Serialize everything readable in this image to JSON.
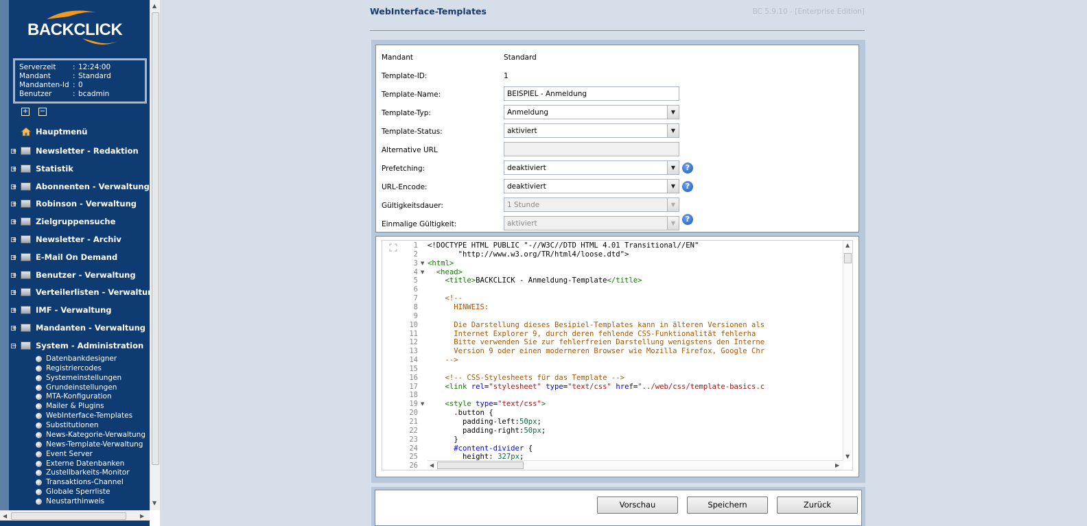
{
  "sidebar": {
    "logo_text": "BACKCLICK",
    "info": [
      {
        "key": "Serverzeit",
        "sep": ":",
        "value": "12:24:00"
      },
      {
        "key": "Mandant",
        "sep": ":",
        "value": "Standard"
      },
      {
        "key": "Mandanten-Id",
        "sep": ":",
        "value": "0"
      },
      {
        "key": "Benutzer",
        "sep": ":",
        "value": "bcadmin"
      }
    ],
    "expand_all": "+",
    "collapse_all": "−",
    "home": "Hauptmenü",
    "items": [
      {
        "label": "Newsletter - Redaktion",
        "exp": "+"
      },
      {
        "label": "Statistik",
        "exp": "+"
      },
      {
        "label": "Abonnenten - Verwaltung",
        "exp": "+"
      },
      {
        "label": "Robinson - Verwaltung",
        "exp": "+"
      },
      {
        "label": "Zielgruppensuche",
        "exp": "+"
      },
      {
        "label": "Newsletter - Archiv",
        "exp": "+"
      },
      {
        "label": "E-Mail On Demand",
        "exp": "+"
      },
      {
        "label": "Benutzer - Verwaltung",
        "exp": "+"
      },
      {
        "label": "Verteilerlisten - Verwaltung",
        "exp": "+"
      },
      {
        "label": "IMF - Verwaltung",
        "exp": "+"
      },
      {
        "label": "Mandanten - Verwaltung",
        "exp": "+"
      },
      {
        "label": "System - Administration",
        "exp": "−"
      }
    ],
    "subitems": [
      "Datenbankdesigner",
      "Registriercodes",
      "Systemeinstellungen",
      "Grundeinstellungen",
      "MTA-Konfiguration",
      "Mailer & Plugins",
      "WebInterface-Templates",
      "Substitutionen",
      "News-Kategorie-Verwaltung",
      "News-Template-Verwaltung",
      "Event Server",
      "Externe Datenbanken",
      "Zustellbarkeits-Monitor",
      "Transaktions-Channel",
      "Globale Sperrliste",
      "Neustarthinweis"
    ]
  },
  "header": {
    "title": "WebInterface-Templates",
    "version": "BC 5.9.10 - [Enterprise Edition]"
  },
  "form": {
    "mandant_label": "Mandant",
    "mandant_value": "Standard",
    "template_id_label": "Template-ID:",
    "template_id_value": "1",
    "template_name_label": "Template-Name:",
    "template_name_value": "BEISPIEL - Anmeldung",
    "template_typ_label": "Template-Typ:",
    "template_typ_value": "Anmeldung",
    "template_status_label": "Template-Status:",
    "template_status_value": "aktiviert",
    "alt_url_label": "Alternative URL",
    "alt_url_value": "",
    "prefetching_label": "Prefetching:",
    "prefetching_value": "deaktiviert",
    "url_encode_label": "URL-Encode:",
    "url_encode_value": "deaktiviert",
    "gueltigkeit_label": "Gültigkeitsdauer:",
    "gueltigkeit_value": "1 Stunde",
    "einmalig_label": "Einmalige Gültigkeit:",
    "einmalig_value": "aktiviert",
    "help_symbol": "?"
  },
  "editor": {
    "lines": [
      {
        "n": "1",
        "fold": "",
        "segs": [
          [
            "c-kw",
            "<!DOCTYPE HTML PUBLIC \"-//W3C//DTD HTML 4.01 Transitional//EN\""
          ]
        ]
      },
      {
        "n": "2",
        "fold": "",
        "segs": [
          [
            "c-kw",
            "       \"http://www.w3.org/TR/html4/loose.dtd\">"
          ]
        ]
      },
      {
        "n": "3",
        "fold": "▼",
        "segs": [
          [
            "c-tag",
            "<html>"
          ]
        ]
      },
      {
        "n": "4",
        "fold": "▼",
        "segs": [
          [
            "c-tag",
            "  <head>"
          ]
        ]
      },
      {
        "n": "5",
        "fold": "",
        "segs": [
          [
            "c-tag",
            "    <title>"
          ],
          [
            "c-kw",
            "BACKCLICK - Anmeldung-Template"
          ],
          [
            "c-tag",
            "</title>"
          ]
        ]
      },
      {
        "n": "6",
        "fold": "",
        "segs": [
          [
            "c-kw",
            ""
          ]
        ]
      },
      {
        "n": "7",
        "fold": "",
        "segs": [
          [
            "c-cmt",
            "    <!--"
          ]
        ]
      },
      {
        "n": "8",
        "fold": "",
        "segs": [
          [
            "c-cmt",
            "      HINWEIS:"
          ]
        ]
      },
      {
        "n": "9",
        "fold": "",
        "segs": [
          [
            "c-cmt",
            ""
          ]
        ]
      },
      {
        "n": "10",
        "fold": "",
        "segs": [
          [
            "c-cmt",
            "      Die Darstellung dieses Besipiel-Templates kann in älteren Versionen als"
          ]
        ]
      },
      {
        "n": "11",
        "fold": "",
        "segs": [
          [
            "c-cmt",
            "      Internet Explorer 9, durch deren fehlende CSS-Funktionalität fehlerha"
          ]
        ]
      },
      {
        "n": "12",
        "fold": "",
        "segs": [
          [
            "c-cmt",
            "      Bitte verwenden Sie zur fehlerfreien Darstellung wenigstens den Interne"
          ]
        ]
      },
      {
        "n": "13",
        "fold": "",
        "segs": [
          [
            "c-cmt",
            "      Version 9 oder einen moderneren Browser wie Mozilla Firefox, Google Chr"
          ]
        ]
      },
      {
        "n": "14",
        "fold": "",
        "segs": [
          [
            "c-cmt",
            "    -->"
          ]
        ]
      },
      {
        "n": "15",
        "fold": "",
        "segs": [
          [
            "c-kw",
            ""
          ]
        ]
      },
      {
        "n": "16",
        "fold": "",
        "segs": [
          [
            "c-cmt",
            "    <!-- CSS-Stylesheets für das Template -->"
          ]
        ]
      },
      {
        "n": "17",
        "fold": "",
        "segs": [
          [
            "c-tag",
            "    <link "
          ],
          [
            "c-att",
            "rel"
          ],
          [
            "c-kw",
            "="
          ],
          [
            "c-str",
            "\"stylesheet\""
          ],
          [
            "c-kw",
            " "
          ],
          [
            "c-att",
            "type"
          ],
          [
            "c-kw",
            "="
          ],
          [
            "c-str",
            "\"text/css\""
          ],
          [
            "c-kw",
            " "
          ],
          [
            "c-att",
            "href"
          ],
          [
            "c-kw",
            "="
          ],
          [
            "c-str",
            "\"../web/css/template-basics.c"
          ]
        ]
      },
      {
        "n": "18",
        "fold": "",
        "segs": [
          [
            "c-kw",
            ""
          ]
        ]
      },
      {
        "n": "19",
        "fold": "▼",
        "segs": [
          [
            "c-tag",
            "    <style "
          ],
          [
            "c-att",
            "type"
          ],
          [
            "c-kw",
            "="
          ],
          [
            "c-str",
            "\"text/css\""
          ],
          [
            "c-tag",
            ">"
          ]
        ]
      },
      {
        "n": "20",
        "fold": "",
        "segs": [
          [
            "c-kw",
            "      .button {"
          ]
        ]
      },
      {
        "n": "21",
        "fold": "",
        "segs": [
          [
            "c-kw",
            "        padding-left:"
          ],
          [
            "c-num",
            "50px"
          ],
          [
            "c-kw",
            ";"
          ]
        ]
      },
      {
        "n": "22",
        "fold": "",
        "segs": [
          [
            "c-kw",
            "        padding-right:"
          ],
          [
            "c-num",
            "50px"
          ],
          [
            "c-kw",
            ";"
          ]
        ]
      },
      {
        "n": "23",
        "fold": "",
        "segs": [
          [
            "c-kw",
            "      }"
          ]
        ]
      },
      {
        "n": "24",
        "fold": "",
        "segs": [
          [
            "c-def",
            "      #content-divider"
          ],
          [
            "c-kw",
            " {"
          ]
        ]
      },
      {
        "n": "25",
        "fold": "",
        "segs": [
          [
            "c-kw",
            "        height: "
          ],
          [
            "c-num",
            "327px"
          ],
          [
            "c-kw",
            ";"
          ]
        ]
      },
      {
        "n": "26",
        "fold": "",
        "segs": [
          [
            "c-kw",
            ""
          ]
        ]
      }
    ]
  },
  "buttons": {
    "preview": "Vorschau",
    "save": "Speichern",
    "back": "Zurück"
  }
}
